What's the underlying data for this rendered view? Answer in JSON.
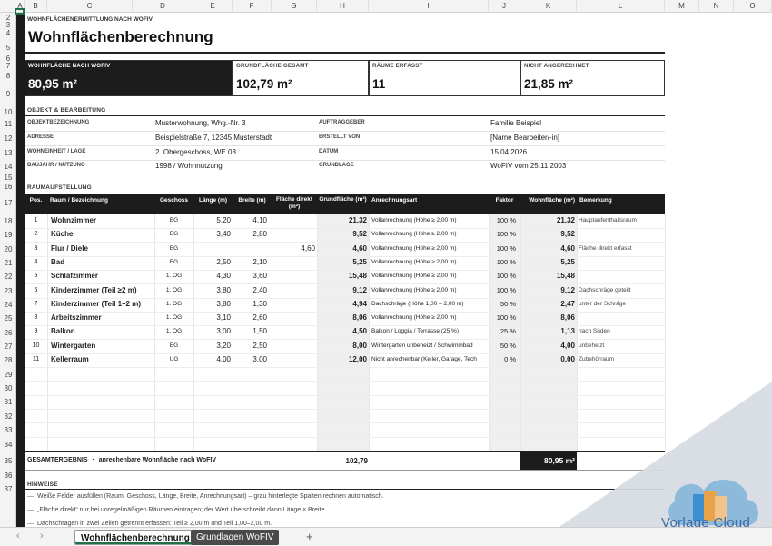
{
  "columns": [
    "A",
    "B",
    "C",
    "D",
    "E",
    "F",
    "G",
    "H",
    "I",
    "J",
    "K",
    "L",
    "M",
    "N",
    "O"
  ],
  "rows": [
    "2",
    "3",
    "4",
    "5",
    "6",
    "7",
    "8",
    "9",
    "10",
    "11",
    "12",
    "13",
    "14",
    "15",
    "16",
    "17",
    "18",
    "19",
    "20",
    "21",
    "22",
    "23",
    "24",
    "25",
    "26",
    "27",
    "28",
    "29",
    "30",
    "31",
    "32",
    "33",
    "34",
    "35",
    "36",
    "37"
  ],
  "eyebrow": "WOHNFLÄCHENERMITTLUNG NACH WOFIV",
  "title": "Wohnflächenberechnung",
  "kpis": [
    {
      "label": "WOHNFLÄCHE NACH WOFIV",
      "value": "80,95 m²"
    },
    {
      "label": "GRUNDFLÄCHE GESAMT",
      "value": "102,79 m²"
    },
    {
      "label": "RÄUME ERFASST",
      "value": "11"
    },
    {
      "label": "NICHT ANGERECHNET",
      "value": "21,85 m²"
    }
  ],
  "objekt": {
    "heading": "OBJEKT & BEARBEITUNG",
    "rows": [
      {
        "l1": "OBJEKTBEZEICHNUNG",
        "v1": "Musterwohnung, Whg.-Nr. 3",
        "l2": "AUFTRAGGEBER",
        "v2": "Familie Beispiel"
      },
      {
        "l1": "ADRESSE",
        "v1": "Beispielstraße 7, 12345 Musterstadt",
        "l2": "ERSTELLT VON",
        "v2": "[Name Bearbeiter/-in]"
      },
      {
        "l1": "WOHNEINHEIT / LAGE",
        "v1": "2. Obergeschoss, WE 03",
        "l2": "DATUM",
        "v2": "15.04.2026"
      },
      {
        "l1": "BAUJAHR / NUTZUNG",
        "v1": "1998 / Wohnnutzung",
        "l2": "GRUNDLAGE",
        "v2": "WoFIV vom 25.11.2003"
      }
    ]
  },
  "raum": {
    "heading": "RAUMAUFSTELLUNG",
    "headers": [
      "Pos.",
      "Raum / Bezeichnung",
      "Geschoss",
      "Länge (m)",
      "Breite (m)",
      "Fläche direkt (m²)",
      "Grundfläche (m²)",
      "Anrechnungsart",
      "Faktor",
      "Wohnfläche (m²)",
      "Bemerkung"
    ],
    "rows": [
      {
        "pos": "1",
        "raum": "Wohnzimmer",
        "gs": "EG",
        "l": "5,20",
        "b": "4,10",
        "fd": "",
        "gf": "21,32",
        "art": "Vollanrechnung (Höhe ≥ 2,00 m)",
        "f": "100 %",
        "wf": "21,32",
        "bem": "Hauptaufenthaltsraum"
      },
      {
        "pos": "2",
        "raum": "Küche",
        "gs": "EG",
        "l": "3,40",
        "b": "2,80",
        "fd": "",
        "gf": "9,52",
        "art": "Vollanrechnung (Höhe ≥ 2,00 m)",
        "f": "100 %",
        "wf": "9,52",
        "bem": ""
      },
      {
        "pos": "3",
        "raum": "Flur / Diele",
        "gs": "EG",
        "l": "",
        "b": "",
        "fd": "4,60",
        "gf": "4,60",
        "art": "Vollanrechnung (Höhe ≥ 2,00 m)",
        "f": "100 %",
        "wf": "4,60",
        "bem": "Fläche direkt erfasst"
      },
      {
        "pos": "4",
        "raum": "Bad",
        "gs": "EG",
        "l": "2,50",
        "b": "2,10",
        "fd": "",
        "gf": "5,25",
        "art": "Vollanrechnung (Höhe ≥ 2,00 m)",
        "f": "100 %",
        "wf": "5,25",
        "bem": ""
      },
      {
        "pos": "5",
        "raum": "Schlafzimmer",
        "gs": "1. OG",
        "l": "4,30",
        "b": "3,60",
        "fd": "",
        "gf": "15,48",
        "art": "Vollanrechnung (Höhe ≥ 2,00 m)",
        "f": "100 %",
        "wf": "15,48",
        "bem": ""
      },
      {
        "pos": "6",
        "raum": "Kinderzimmer (Teil ≥2 m)",
        "gs": "1. OG",
        "l": "3,80",
        "b": "2,40",
        "fd": "",
        "gf": "9,12",
        "art": "Vollanrechnung (Höhe ≥ 2,00 m)",
        "f": "100 %",
        "wf": "9,12",
        "bem": "Dachschräge geteilt"
      },
      {
        "pos": "7",
        "raum": "Kinderzimmer (Teil 1–2 m)",
        "gs": "1. OG",
        "l": "3,80",
        "b": "1,30",
        "fd": "",
        "gf": "4,94",
        "art": "Dachschräge (Höhe 1,00 – 2,00 m)",
        "f": "50 %",
        "wf": "2,47",
        "bem": "unter der Schräge"
      },
      {
        "pos": "8",
        "raum": "Arbeitszimmer",
        "gs": "1. OG",
        "l": "3,10",
        "b": "2,60",
        "fd": "",
        "gf": "8,06",
        "art": "Vollanrechnung (Höhe ≥ 2,00 m)",
        "f": "100 %",
        "wf": "8,06",
        "bem": ""
      },
      {
        "pos": "9",
        "raum": "Balkon",
        "gs": "1. OG",
        "l": "3,00",
        "b": "1,50",
        "fd": "",
        "gf": "4,50",
        "art": "Balkon / Loggia / Terrasse (25 %)",
        "f": "25 %",
        "wf": "1,13",
        "bem": "nach Süden"
      },
      {
        "pos": "10",
        "raum": "Wintergarten",
        "gs": "EG",
        "l": "3,20",
        "b": "2,50",
        "fd": "",
        "gf": "8,00",
        "art": "Wintergarten unbeheizt / Schwimmbad",
        "f": "50 %",
        "wf": "4,00",
        "bem": "unbeheizt"
      },
      {
        "pos": "11",
        "raum": "Kellerraum",
        "gs": "UG",
        "l": "4,00",
        "b": "3,00",
        "fd": "",
        "gf": "12,00",
        "art": "Nicht anrechenbar (Keller, Garage, Tech",
        "f": "0 %",
        "wf": "0,00",
        "bem": "Zubehörraum"
      }
    ]
  },
  "total": {
    "label": "GESAMTERGEBNIS",
    "sub": "anrechenbare Wohnfläche nach WoFIV",
    "sep": "·",
    "grund": "102,79",
    "wohn": "80,95 m²"
  },
  "hinweise": {
    "heading": "HINWEISE",
    "items": [
      "Weiße Felder ausfüllen (Raum, Geschoss, Länge, Breite, Anrechnungsart) – grau hinterlegte Spalten rechnen automatisch.",
      "„Fläche direkt“ nur bei unregelmäßigen Räumen eintragen; der Wert überschreibt dann Länge × Breite.",
      "Dachschrägen in zwei Zeilen getrennt erfassen: Teil ≥ 2,00 m und Teil 1,00–2,00 m."
    ],
    "bullet": "—"
  },
  "tabs": {
    "active": "Wohnflächenberechnung",
    "other": "Grundlagen WoFIV",
    "add": "+",
    "prev": "‹",
    "next": "›"
  },
  "watermark": {
    "text": "Vorlage Cloud"
  }
}
